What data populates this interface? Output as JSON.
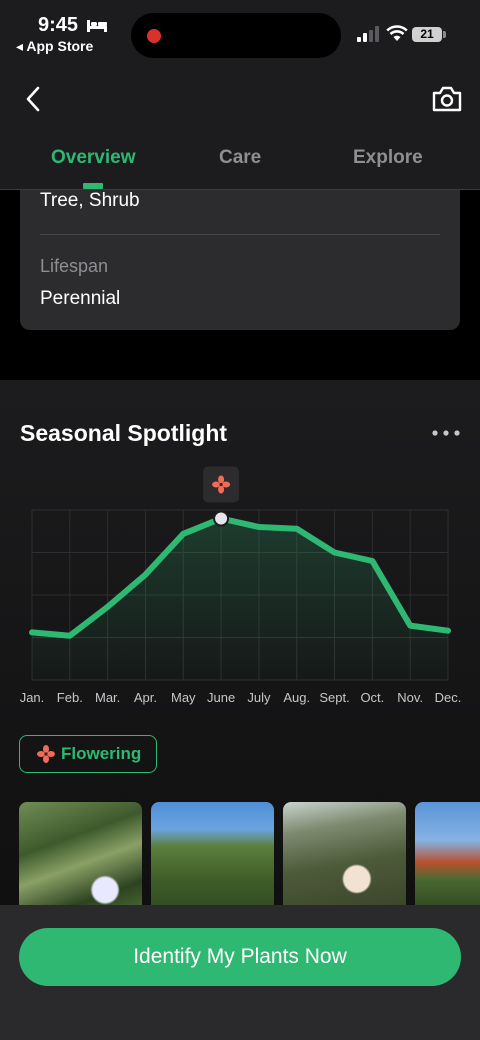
{
  "status_bar": {
    "time": "9:45",
    "back_label": "◂ App Store",
    "battery": "21"
  },
  "header": {
    "tabs": [
      {
        "label": "Overview",
        "active": true
      },
      {
        "label": "Care",
        "active": false
      },
      {
        "label": "Explore",
        "active": false
      }
    ],
    "icons": [
      "back-chevron-icon",
      "camera-icon"
    ]
  },
  "info_card": {
    "type_value": "Tree, Shrub",
    "lifespan_label": "Lifespan",
    "lifespan_value": "Perennial"
  },
  "seasonal": {
    "title": "Seasonal Spotlight",
    "chip_label": "Flowering",
    "cta_label": "Identify My Plants Now"
  },
  "colors": {
    "accent": "#2eb872",
    "flower": "#f26a5a",
    "background": "#000000",
    "card": "#2c2c2e"
  },
  "chart_data": {
    "type": "line",
    "categories": [
      "Jan.",
      "Feb.",
      "Mar.",
      "Apr.",
      "May",
      "June",
      "July",
      "Aug.",
      "Sept.",
      "Oct.",
      "Nov.",
      "Dec."
    ],
    "series": [
      {
        "values": [
          28,
          26,
          43,
          62,
          86,
          95,
          90,
          89,
          75,
          70,
          32,
          29
        ]
      }
    ],
    "ylim": [
      0,
      100
    ],
    "highlight_index": 5,
    "grid": true
  }
}
